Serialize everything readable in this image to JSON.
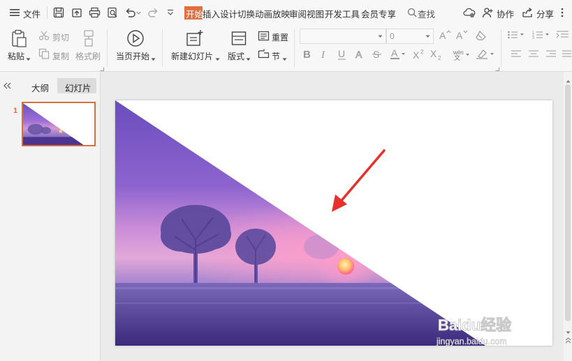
{
  "menubar": {
    "file_label": "文件",
    "tabs": [
      "开始",
      "插入",
      "设计",
      "切换",
      "动画",
      "放映",
      "审阅",
      "视图",
      "开发工具",
      "会员专享"
    ],
    "search_label": "查找",
    "collab_label": "协作",
    "share_label": "分享"
  },
  "ribbon": {
    "paste": "粘贴",
    "cut": "剪切",
    "copy": "复制",
    "format_painter": "格式刷",
    "play_from_current": "当页开始",
    "new_slide": "新建幻灯片",
    "layout": "版式",
    "reset": "重置",
    "section": "节",
    "font_name": "",
    "font_size": "0"
  },
  "leftpanel": {
    "tab_outline": "大纲",
    "tab_slides": "幻灯片",
    "slide_number": "1"
  },
  "watermark": {
    "line1": "Baidu经验",
    "line2": "jingyan.baidu.com"
  },
  "colors": {
    "active_tab_bg": "#e0703f",
    "accent_orange": "#d9713f",
    "arrow_red": "#e8302b"
  }
}
